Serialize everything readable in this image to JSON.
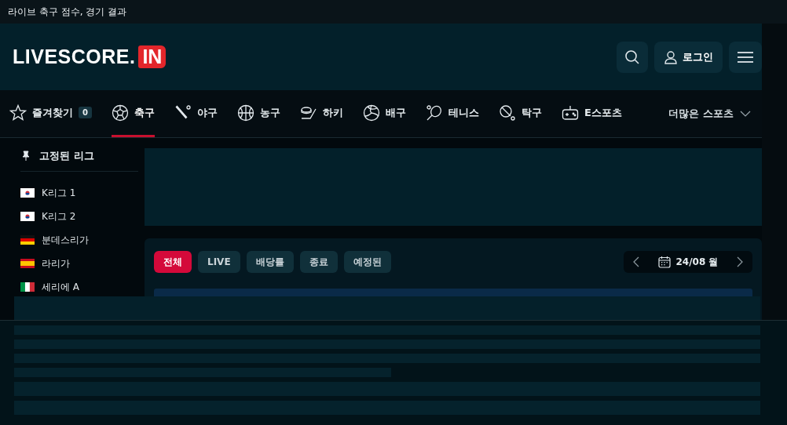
{
  "top_bar": {
    "title": "라이브 축구 점수, 경기 결과"
  },
  "header": {
    "logo_text": "LIVESCORE.",
    "logo_badge": "IN",
    "login_label": "로그인"
  },
  "sports_nav": {
    "items": [
      {
        "kind": "star",
        "label": "즐겨찾기",
        "count": "0",
        "selected": false
      },
      {
        "kind": "soccer",
        "label": "축구",
        "selected": true
      },
      {
        "kind": "baseball",
        "label": "야구",
        "selected": false
      },
      {
        "kind": "basketball",
        "label": "농구",
        "selected": false
      },
      {
        "kind": "hockey",
        "label": "하키",
        "selected": false
      },
      {
        "kind": "volleyball",
        "label": "배구",
        "selected": false
      },
      {
        "kind": "tennis",
        "label": "테니스",
        "selected": false
      },
      {
        "kind": "pingpong",
        "label": "탁구",
        "selected": false
      },
      {
        "kind": "gamepad",
        "label": "E스포츠",
        "selected": false
      }
    ],
    "more_label": "더많은 스포츠"
  },
  "sidebar": {
    "title": "고정된 리그",
    "items": [
      {
        "kind": "kr",
        "label": "K리그 1"
      },
      {
        "kind": "kr",
        "label": "K리그 2"
      },
      {
        "kind": "de",
        "label": "분데스리가"
      },
      {
        "kind": "es",
        "label": "라리가"
      },
      {
        "kind": "it",
        "label": "세리에 A"
      }
    ]
  },
  "filters": [
    {
      "label": "전체",
      "selected": true
    },
    {
      "label": "LIVE",
      "selected": false
    },
    {
      "label": "배당률",
      "selected": false
    },
    {
      "label": "종료",
      "selected": false
    },
    {
      "label": "예정된",
      "selected": false
    }
  ],
  "date_nav": {
    "label": "24/08 월"
  }
}
